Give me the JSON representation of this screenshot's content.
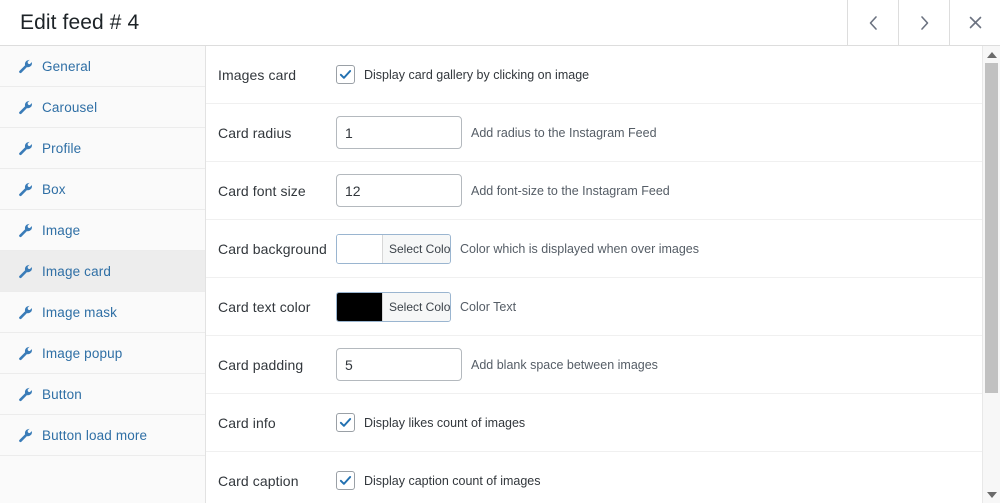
{
  "header": {
    "title": "Edit feed # 4",
    "buttons": [
      {
        "name": "prev-feed-button",
        "icon": "chevron-left-icon",
        "label": "‹"
      },
      {
        "name": "next-feed-button",
        "icon": "chevron-right-icon",
        "label": "›"
      },
      {
        "name": "close-modal-button",
        "icon": "close-icon",
        "label": "×"
      }
    ]
  },
  "sidebar": {
    "items": [
      {
        "label": "General",
        "icon": "wrench-icon",
        "active": false
      },
      {
        "label": "Carousel",
        "icon": "wrench-icon",
        "active": false
      },
      {
        "label": "Profile",
        "icon": "wrench-icon",
        "active": false
      },
      {
        "label": "Box",
        "icon": "wrench-icon",
        "active": false
      },
      {
        "label": "Image",
        "icon": "wrench-icon",
        "active": false
      },
      {
        "label": "Image card",
        "icon": "wrench-icon",
        "active": true
      },
      {
        "label": "Image mask",
        "icon": "wrench-icon",
        "active": false
      },
      {
        "label": "Image popup",
        "icon": "wrench-icon",
        "active": false
      },
      {
        "label": "Button",
        "icon": "wrench-icon",
        "active": false
      },
      {
        "label": "Button load more",
        "icon": "wrench-icon",
        "active": false
      }
    ]
  },
  "settings": {
    "rows": [
      {
        "label": "Images card",
        "type": "checkbox",
        "checked": true,
        "checkbox_label": "Display card gallery by clicking on image",
        "hint": ""
      },
      {
        "label": "Card radius",
        "type": "text",
        "value": "1",
        "hint": "Add radius to the Instagram Feed"
      },
      {
        "label": "Card font size",
        "type": "text",
        "value": "12",
        "hint": "Add font-size to the Instagram Feed"
      },
      {
        "label": "Card background",
        "type": "color",
        "swatch": "#ffffff",
        "button_label": "Select Color",
        "hint": "Color which is displayed when over images"
      },
      {
        "label": "Card text color",
        "type": "color",
        "swatch": "#000000",
        "button_label": "Select Color",
        "hint": "Color Text"
      },
      {
        "label": "Card padding",
        "type": "text",
        "value": "5",
        "hint": "Add blank space between images"
      },
      {
        "label": "Card info",
        "type": "checkbox",
        "checked": true,
        "checkbox_label": "Display likes count of images",
        "hint": ""
      },
      {
        "label": "Card caption",
        "type": "checkbox",
        "checked": true,
        "checkbox_label": "Display caption count of images",
        "hint": ""
      }
    ]
  },
  "scrollbar": {
    "up_arrow": "scroll-up-arrow",
    "down_arrow": "scroll-down-arrow",
    "thumb_position_percent": 0
  },
  "colors": {
    "accent_link": "#2f6fa5",
    "checkbox_check": "#2271b1",
    "text_primary": "#32373c",
    "text_hint": "#555d66",
    "sidebar_bg": "#fafafa",
    "sidebar_active_bg": "#ededed",
    "border": "#dddddd"
  }
}
